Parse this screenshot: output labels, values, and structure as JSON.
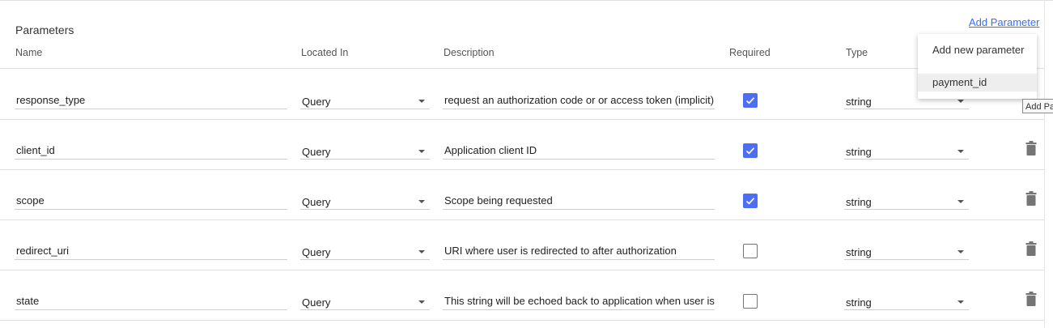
{
  "section": {
    "title": "Parameters",
    "add_link": "Add Parameter"
  },
  "columns": {
    "name": "Name",
    "located_in": "Located In",
    "description": "Description",
    "required": "Required",
    "type": "Type"
  },
  "rows": [
    {
      "name": "response_type",
      "located_in": "Query",
      "description": "request an authorization code or or access token (implicit)",
      "required": true,
      "type": "string"
    },
    {
      "name": "client_id",
      "located_in": "Query",
      "description": "Application client ID",
      "required": true,
      "type": "string"
    },
    {
      "name": "scope",
      "located_in": "Query",
      "description": "Scope being requested",
      "required": true,
      "type": "string"
    },
    {
      "name": "redirect_uri",
      "located_in": "Query",
      "description": "URI where user is redirected to after authorization",
      "required": false,
      "type": "string"
    },
    {
      "name": "state",
      "located_in": "Query",
      "description": "This string will be echoed back to application when user is",
      "required": false,
      "type": "string"
    }
  ],
  "menu": {
    "items": [
      {
        "label": "Add new parameter"
      },
      {
        "label": "payment_id"
      }
    ]
  },
  "tooltip": "Add Parameter",
  "colors": {
    "accent": "#4d6ef2",
    "link": "#3a6ee8",
    "rule": "#e0e0e0"
  }
}
